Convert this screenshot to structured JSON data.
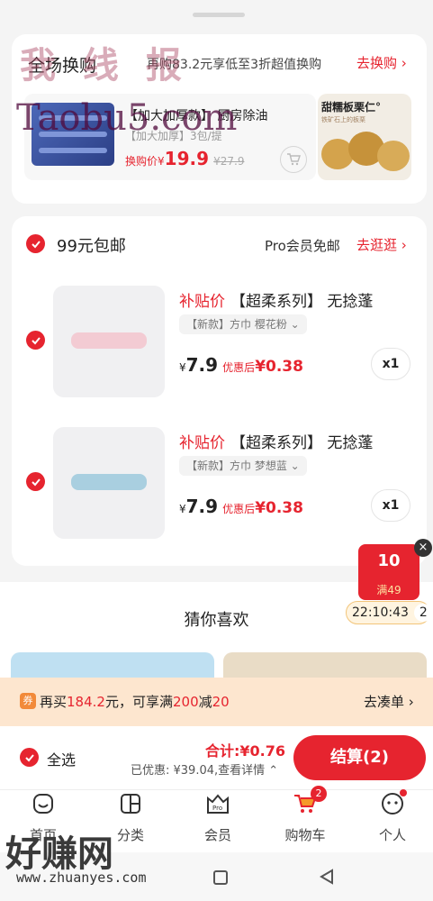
{
  "exchange": {
    "title": "全场换购",
    "subtitle": "再购83.2元享低至3折超值换购",
    "link": "去换购",
    "item1_name": "【加大加厚款】 厨房除油",
    "item1_spec": "【加大加厚】3包/提",
    "item1_price_label": "换购价",
    "item1_currency": "¥",
    "item1_price": "19.9",
    "item1_orig_price": "¥27.9",
    "item2_label": "甜糯板栗仁°",
    "item2_sub": "铁矿石上的板栗"
  },
  "shipping": {
    "title": "99元包邮",
    "pro_text": "Pro会员免邮",
    "link": "去逛逛"
  },
  "products": [
    {
      "tag": "补贴价",
      "title": "【超柔系列】 无捻蓬",
      "spec": "【新款】方巾 樱花粉",
      "currency": "¥",
      "price": "7.9",
      "after_label": "优惠后",
      "after_price": "¥0.38",
      "qty": "x1",
      "color": "#f3cbd3"
    },
    {
      "tag": "补贴价",
      "title": "【超柔系列】 无捻蓬",
      "spec": "【新款】方巾 梦想蓝",
      "currency": "¥",
      "price": "7.9",
      "after_label": "优惠后",
      "after_price": "¥0.38",
      "qty": "x1",
      "color": "#a9cfe0"
    }
  ],
  "coupon": {
    "amount": "10",
    "condition": "满49",
    "timer": "22:10:43",
    "count": "2"
  },
  "guess": {
    "title": "猜你喜欢"
  },
  "promo": {
    "icon": "券",
    "text1": "再买",
    "amount": "184.2",
    "text2": "元，可享满",
    "threshold": "200",
    "text3": "减",
    "discount": "20",
    "link": "去凑单"
  },
  "checkout": {
    "select_all": "全选",
    "total_label": "合计:",
    "total": "¥0.76",
    "saved": "已优惠: ¥39.04,查看详情",
    "button": "结算(2)"
  },
  "nav": [
    {
      "label": "首页",
      "icon": "home-icon"
    },
    {
      "label": "分类",
      "icon": "category-icon"
    },
    {
      "label": "会员",
      "icon": "pro-icon"
    },
    {
      "label": "购物车",
      "icon": "cart-icon",
      "badge": "2"
    },
    {
      "label": "个人",
      "icon": "profile-icon"
    }
  ],
  "watermarks": {
    "top": "我 线 报",
    "url": "Taobu5.com",
    "bottom": "好赚网",
    "bottom_url": "www.zhuanyes.com"
  },
  "colors": {
    "accent": "#e6242f",
    "promo_bg": "#fde6cf"
  }
}
